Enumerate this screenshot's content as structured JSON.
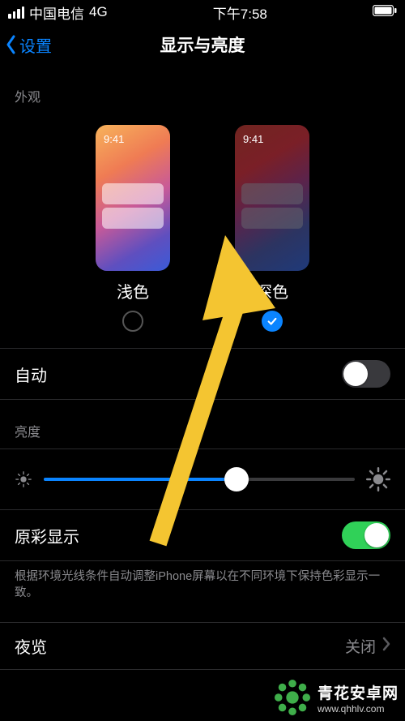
{
  "status": {
    "carrier": "中国电信",
    "network": "4G",
    "time": "下午7:58"
  },
  "nav": {
    "back": "设置",
    "title": "显示与亮度"
  },
  "appearance": {
    "header": "外观",
    "preview_time": "9:41",
    "modes": [
      {
        "label": "浅色",
        "selected": false
      },
      {
        "label": "深色",
        "selected": true
      }
    ],
    "auto_label": "自动",
    "auto_on": false
  },
  "brightness": {
    "header": "亮度",
    "value_pct": 62,
    "true_tone_label": "原彩显示",
    "true_tone_on": true,
    "true_tone_note": "根据环境光线条件自动调整iPhone屏幕以在不同环境下保持色彩显示一致。"
  },
  "night": {
    "label": "夜览",
    "value": "关闭"
  },
  "watermark": {
    "name": "青花安卓网",
    "url": "www.qhhlv.com"
  }
}
